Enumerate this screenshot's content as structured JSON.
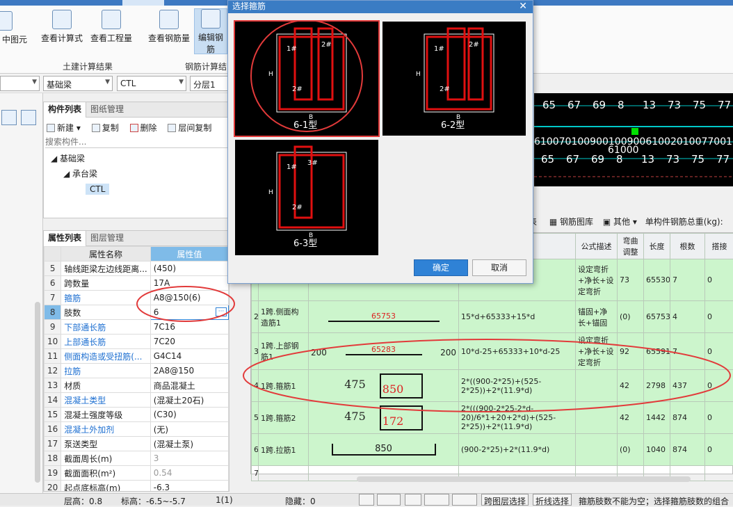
{
  "ribbon": {
    "buttons": [
      {
        "label": "中图元"
      },
      {
        "label": "查看计算式"
      },
      {
        "label": "查看工程量"
      },
      {
        "label": "查看钢筋量"
      },
      {
        "label": "编辑钢筋"
      }
    ],
    "group_civil": "土建计算结果",
    "group_rebar": "钢筋计算结"
  },
  "selectors": {
    "type": "基础梁",
    "name": "CTL",
    "floor": "分层1"
  },
  "component_panel": {
    "tab_list": "构件列表",
    "tab_drawing": "图纸管理",
    "tools": {
      "new": "新建",
      "copy": "复制",
      "delete": "删除",
      "floor_copy": "层间复制"
    },
    "search_placeholder": "搜索构件...",
    "tree": {
      "root": "基础梁",
      "child": "承台梁",
      "leaf": "CTL"
    }
  },
  "property_panel": {
    "tab_list": "属性列表",
    "tab_layer": "图层管理",
    "col_name": "属性名称",
    "col_value": "属性值",
    "rows": [
      {
        "n": "5",
        "name": "轴线距梁左边线距离...",
        "value": "(450)"
      },
      {
        "n": "6",
        "name": "跨数量",
        "value": "17A"
      },
      {
        "n": "7",
        "name": "箍筋",
        "value": "A8@150(6)"
      },
      {
        "n": "8",
        "name": "肢数",
        "value": "6"
      },
      {
        "n": "9",
        "name": "下部通长筋",
        "value": "7C16"
      },
      {
        "n": "10",
        "name": "上部通长筋",
        "value": "7C20"
      },
      {
        "n": "11",
        "name": "侧面构造或受扭筋(...",
        "value": "G4C14"
      },
      {
        "n": "12",
        "name": "拉筋",
        "value": "2A8@150"
      },
      {
        "n": "13",
        "name": "材质",
        "value": "商品混凝土"
      },
      {
        "n": "14",
        "name": "混凝土类型",
        "value": "(混凝土20石)"
      },
      {
        "n": "15",
        "name": "混凝土强度等级",
        "value": "(C30)"
      },
      {
        "n": "16",
        "name": "混凝土外加剂",
        "value": "(无)"
      },
      {
        "n": "17",
        "name": "泵送类型",
        "value": "(混凝土泵)"
      },
      {
        "n": "18",
        "name": "截面周长(m)",
        "value": "3"
      },
      {
        "n": "19",
        "name": "截面面积(m²)",
        "value": "0.54"
      },
      {
        "n": "20",
        "name": "起点底标高(m)",
        "value": "-6.3"
      }
    ]
  },
  "canvas": {
    "labels": [
      "65",
      "67",
      "69",
      "8",
      "13",
      "73",
      "75",
      "77"
    ],
    "dims": "6100701009001009006100201007700100200",
    "big": "61000"
  },
  "rebar_toolbar": {
    "left": "表",
    "library": "钢筋图库",
    "other": "其他",
    "total": "单构件钢筋总重(kg):"
  },
  "rebar_grid": {
    "headers": {
      "formula_desc": "公式描述",
      "bend": "弯曲调整",
      "length": "长度",
      "count": "根数",
      "lap": "搭接"
    },
    "rows": [
      {
        "n": "",
        "name": "",
        "shape": "",
        "formula": "...d-25",
        "desc": "设定弯折+净长+设定弯折",
        "bend": "73",
        "length": "65530",
        "count": "7",
        "lap": "0"
      },
      {
        "n": "2",
        "name": "1跨.侧面构造筋1",
        "shape": "65753",
        "formula": "15*d+65333+15*d",
        "desc": "锚固+净长+锚固",
        "bend": "(0)",
        "length": "65753",
        "count": "4",
        "lap": "0"
      },
      {
        "n": "3",
        "name": "1跨.上部钢筋1",
        "shape": "65283",
        "shape_l": "200",
        "shape_r": "200",
        "formula": "10*d-25+65333+10*d-25",
        "desc": "设定弯折+净长+设定弯折",
        "bend": "92",
        "length": "65591",
        "count": "7",
        "lap": "0"
      },
      {
        "n": "4",
        "name": "1跨.箍筋1",
        "shape_w": "475",
        "shape_h": "850",
        "formula": "2*((900-2*25)+(525-2*25))+2*(11.9*d)",
        "desc": "",
        "bend": "42",
        "length": "2798",
        "count": "437",
        "lap": "0"
      },
      {
        "n": "5",
        "name": "1跨.箍筋2",
        "shape_w": "475",
        "shape_h": "172",
        "formula": "2*(((900-2*25-2*d-20)/6*1+20+2*d)+(525-2*25))+2*(11.9*d)",
        "desc": "",
        "bend": "42",
        "length": "1442",
        "count": "874",
        "lap": "0"
      },
      {
        "n": "6",
        "name": "1跨.拉筋1",
        "shape": "850",
        "formula": "(900-2*25)+2*(11.9*d)",
        "desc": "",
        "bend": "(0)",
        "length": "1040",
        "count": "874",
        "lap": "0"
      },
      {
        "n": "7",
        "name": "",
        "shape": "",
        "formula": "",
        "desc": "",
        "bend": "",
        "length": "",
        "count": "",
        "lap": ""
      }
    ]
  },
  "dialog": {
    "title": "选择箍筋",
    "options": [
      {
        "caption": "6-1型",
        "top_label": "2#",
        "mid_label": "1#",
        "bottom_label": "2#"
      },
      {
        "caption": "6-2型",
        "top_label": "2#",
        "mid_label": "1#",
        "bottom_label": "2#"
      },
      {
        "caption": "6-3型",
        "top_label": "3#",
        "mid_label": "1#",
        "bottom_label": "2#"
      }
    ],
    "h_label": "H",
    "b_label": "B",
    "ok": "确定",
    "cancel": "取消"
  },
  "status": {
    "floor_height": "层高：0.8",
    "elevation": "标高：-6.5~-5.7",
    "count": "1(1)",
    "hidden": "隐藏：0",
    "layer_select": "跨图层选择",
    "polyline_select": "折线选择",
    "message": "箍筋肢数不能为空；选择箍筋肢数的组合"
  },
  "colors": {
    "accent": "#3a7cc4",
    "highlight": "#e23a3a",
    "row_green": "#ccf5cc",
    "prop_header": "#7fbbe8"
  }
}
